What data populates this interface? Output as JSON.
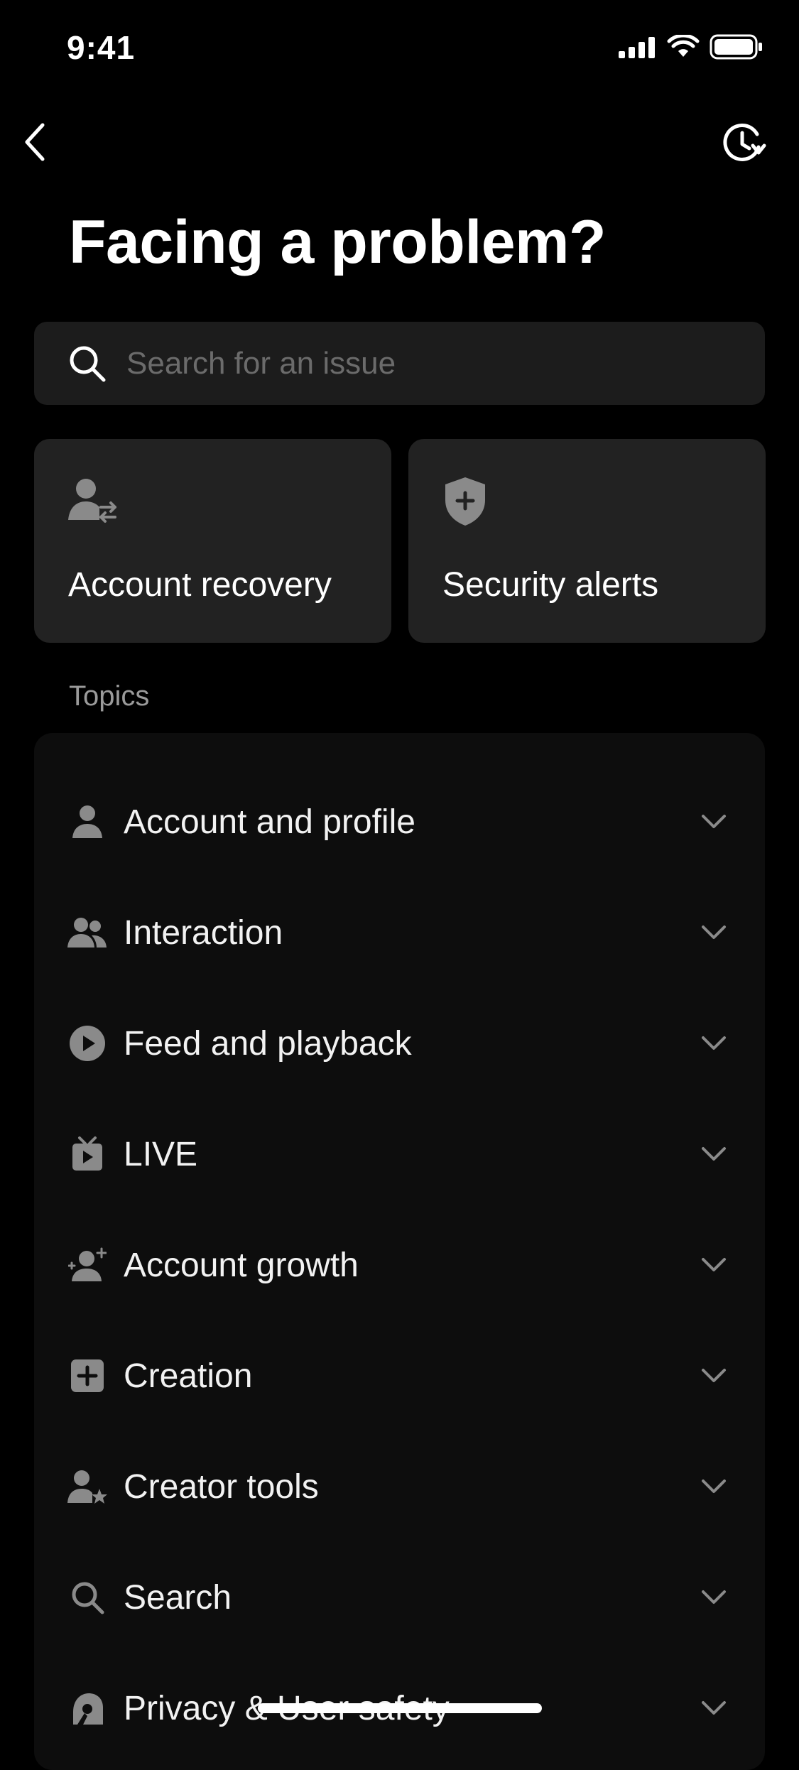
{
  "status_bar": {
    "time": "9:41"
  },
  "page": {
    "title": "Facing a problem?"
  },
  "search": {
    "placeholder": "Search for an issue"
  },
  "quick_actions": [
    {
      "label": "Account recovery",
      "icon": "user-swap-icon"
    },
    {
      "label": "Security alerts",
      "icon": "shield-plus-icon"
    }
  ],
  "topics_section": {
    "label": "Topics",
    "items": [
      {
        "label": "Account and profile",
        "icon": "person-icon"
      },
      {
        "label": "Interaction",
        "icon": "people-icon"
      },
      {
        "label": "Feed and playback",
        "icon": "play-circle-icon"
      },
      {
        "label": "LIVE",
        "icon": "live-tv-icon"
      },
      {
        "label": "Account growth",
        "icon": "person-sparkle-icon"
      },
      {
        "label": "Creation",
        "icon": "plus-square-icon"
      },
      {
        "label": "Creator tools",
        "icon": "person-star-icon"
      },
      {
        "label": "Search",
        "icon": "search-icon"
      },
      {
        "label": "Privacy & User safety",
        "icon": "privacy-icon"
      }
    ]
  },
  "colors": {
    "background": "#000000",
    "card": "#222222",
    "search_field": "#1c1c1c",
    "topic_panel": "#0d0d0d",
    "icon_gray": "#8a8a8a",
    "muted_text": "#9a9a9a"
  }
}
